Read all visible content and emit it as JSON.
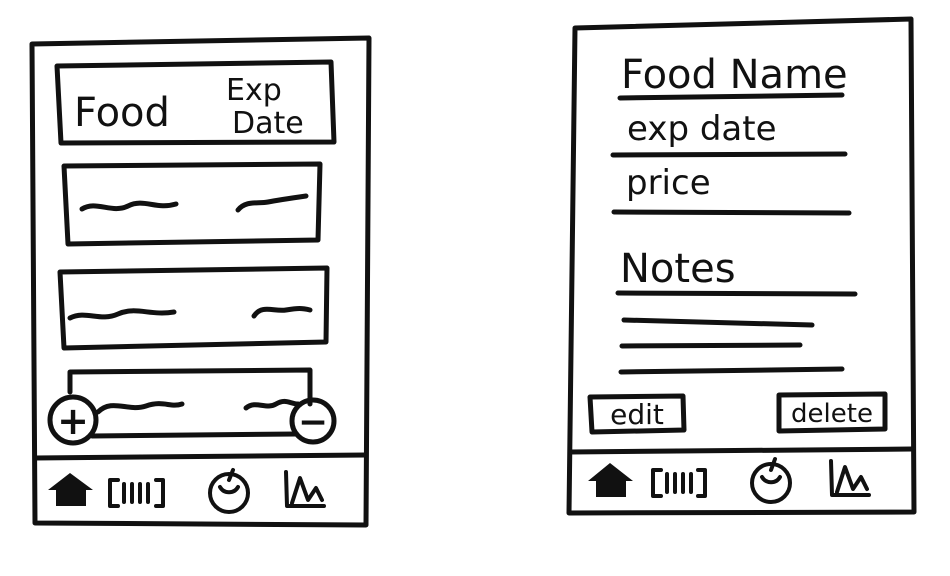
{
  "list_screen": {
    "header": {
      "food_label": "Food",
      "exp_label_line1": "Exp",
      "exp_label_line2": "Date"
    },
    "add_symbol": "+",
    "remove_symbol": "−",
    "nav": {
      "icons": [
        "home-icon",
        "barcode-icon",
        "tomato-icon",
        "chart-icon"
      ]
    }
  },
  "detail_screen": {
    "food_name_label": "Food Name",
    "exp_date_label": "exp date",
    "price_label": "price",
    "notes_label": "Notes",
    "edit_label": "edit",
    "delete_label": "delete",
    "nav": {
      "icons": [
        "home-icon",
        "barcode-icon",
        "tomato-icon",
        "chart-icon"
      ]
    }
  }
}
